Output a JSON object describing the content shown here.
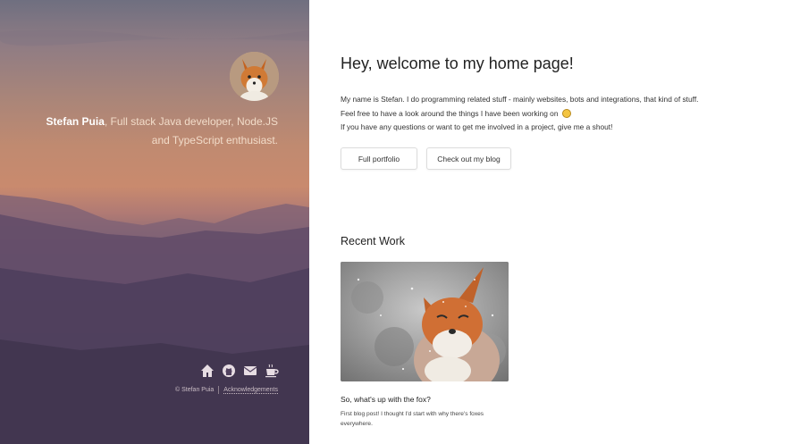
{
  "sidebar": {
    "name": "Stefan Puia",
    "tagline_rest": ", Full stack Java developer, Node.JS and TypeScript enthusiast.",
    "social_icons": [
      "home-icon",
      "github-icon",
      "mail-icon",
      "coffee-icon"
    ],
    "copyright": "© Stefan Puia",
    "acknowledgements": "Acknowledgements"
  },
  "main": {
    "heading": "Hey, welcome to my home page!",
    "intro_lines": [
      "My name is Stefan. I do programming related stuff - mainly websites, bots and integrations, that kind of stuff.",
      "Feel free to have a look around the things I have been working on",
      "If you have any questions or want to get me involved in a project, give me a shout!"
    ],
    "buttons": {
      "portfolio": "Full portfolio",
      "blog": "Check out my blog"
    },
    "recent_work": {
      "title": "Recent Work",
      "card_title": "So, what's up with the fox?",
      "card_desc": "First blog post! I thought I'd start with why there's foxes everywhere."
    }
  }
}
